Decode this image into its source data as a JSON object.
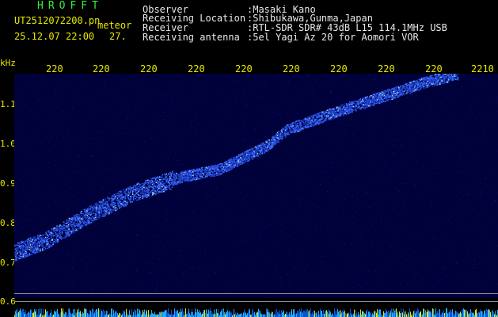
{
  "header": {
    "program": "HROFFT",
    "filename": "UT2512072200.pn",
    "mode": "meteor",
    "datetime": "25.12.07 22:00",
    "count": "27.",
    "fields": [
      {
        "label": "Observer",
        "value": ":Masaki Kano"
      },
      {
        "label": "Receiving Location",
        "value": ":Shibukawa,Gunma,Japan"
      },
      {
        "label": "Receiver",
        "value": ":RTL-SDR SDR# 43dB L15 114.1MHz USB"
      },
      {
        "label": "Receiving antenna",
        "value": ":5el Yagi Az 20 for Aomori VOR"
      }
    ]
  },
  "axes": {
    "y_unit": "kHz",
    "y_ticks": [
      "1.1",
      "1.0",
      "0.9",
      "0.8",
      "0.7",
      "0.6"
    ],
    "x_ticks": [
      "220",
      "220",
      "220",
      "220",
      "220",
      "220",
      "220",
      "220",
      "220",
      "2210"
    ]
  },
  "colors": {
    "background": "#000000",
    "plot_background": "#00003a",
    "trace": "#3a6cff",
    "label_yellow": "#e8e800",
    "title_green": "#33ee33"
  }
}
